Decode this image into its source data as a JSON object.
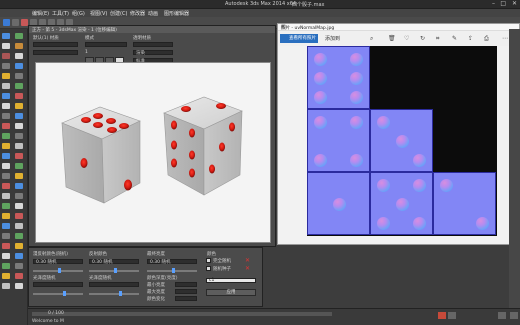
{
  "app_title": "Autodesk 3ds Max  2014 x64",
  "file_name": "四个骰子.max",
  "menu": [
    "编辑(E)",
    "工具(T)",
    "组(G)",
    "视图(V)",
    "创建(C)",
    "修改器",
    "动画",
    "图形编辑器",
    "渲染(R)",
    "自定义(U)",
    "MAXScript(X)",
    "帮助(H)"
  ],
  "mated": {
    "title": "正方 - 第 5 - 3dsMax 渲染 - 1 (位移编辑)",
    "label_top_left": "默认(1) 材质",
    "label_col2": "模式",
    "label_col3": "透明材质",
    "map_channel_value": "1",
    "select_value": "渲染",
    "field_dropdown": "标准"
  },
  "params": {
    "section1": "漫反射颜色(随机)",
    "section2": "反射颜色",
    "section3": "最终亮度",
    "section4": "颜色",
    "value1": "0.30 随机",
    "value2": "0.30 随机",
    "value3": "0.30 随机",
    "row2_label1": "光泽度随机",
    "row2_label2": "光泽度随机",
    "row2_label3": "颜色深度(亮度)",
    "item_a": "最小亮度",
    "item_b": "最大亮度",
    "item_c": "颜色变化",
    "check_1": "完全随机",
    "check_2": "随机种子",
    "apply_button": "应用",
    "dropdown": "c1"
  },
  "photos": {
    "title": "照片 - uvNormalMap.jpg",
    "tab_label": "查看所有照片",
    "add_label": "添加到",
    "toolbar_icons": [
      "zoom-icon",
      "delete-icon",
      "favorite-icon",
      "rotate-icon",
      "crop-icon",
      "edit-icon",
      "share-icon",
      "print-icon",
      "more-icon"
    ]
  },
  "colors": {
    "normal_base": "#8286f5",
    "normal_border": "#2b2b9e",
    "dice_pip": "#cc1111",
    "max_bg": "#3d3d3d",
    "accent_blue": "#2a6fbf"
  },
  "timeline": {
    "frame": "0 / 100",
    "status": "Welcome to M"
  }
}
